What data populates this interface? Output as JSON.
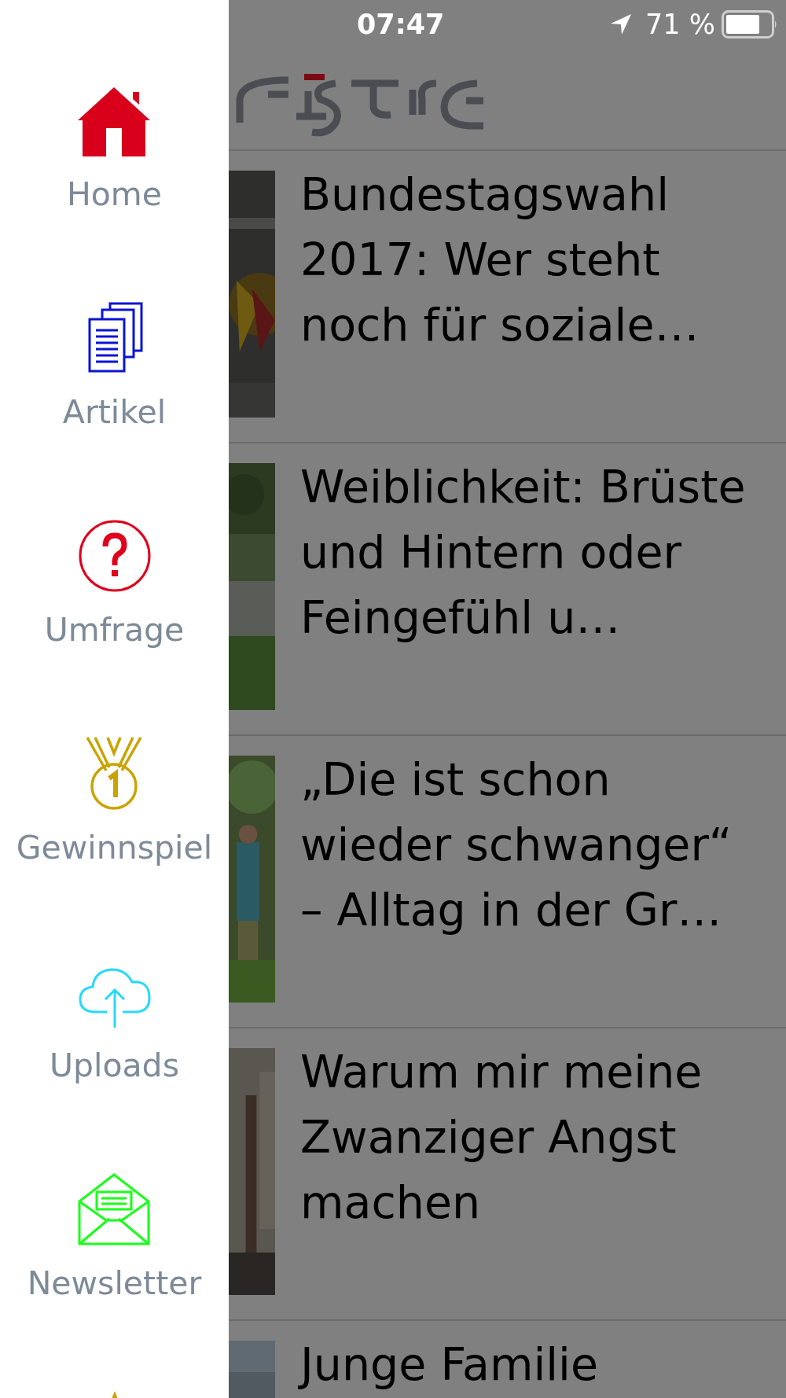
{
  "status_bar": {
    "time": "07:47",
    "battery": "71 %"
  },
  "sidebar": {
    "items": [
      {
        "label": "Home",
        "color": "#d9001b"
      },
      {
        "label": "Artikel",
        "color": "#0a14d2"
      },
      {
        "label": "Umfrage",
        "color": "#e0001b"
      },
      {
        "label": "Gewinnspiel",
        "color": "#c9a400"
      },
      {
        "label": "Uploads",
        "color": "#25d9ff"
      },
      {
        "label": "Newsletter",
        "color": "#19ff19"
      },
      {
        "color": "#c9a400"
      }
    ]
  },
  "articles": [
    {
      "title": "Bundestagswahl 2017: Wer steht noch für soziale…"
    },
    {
      "title": "Weiblichkeit: Brüste und Hintern oder Feingefühl u…"
    },
    {
      "title": "„Die ist schon wieder schwanger“ – Alltag in der Gr…"
    },
    {
      "title": "Warum mir meine Zwanziger Angst machen"
    },
    {
      "title": "Junge Familie"
    }
  ]
}
